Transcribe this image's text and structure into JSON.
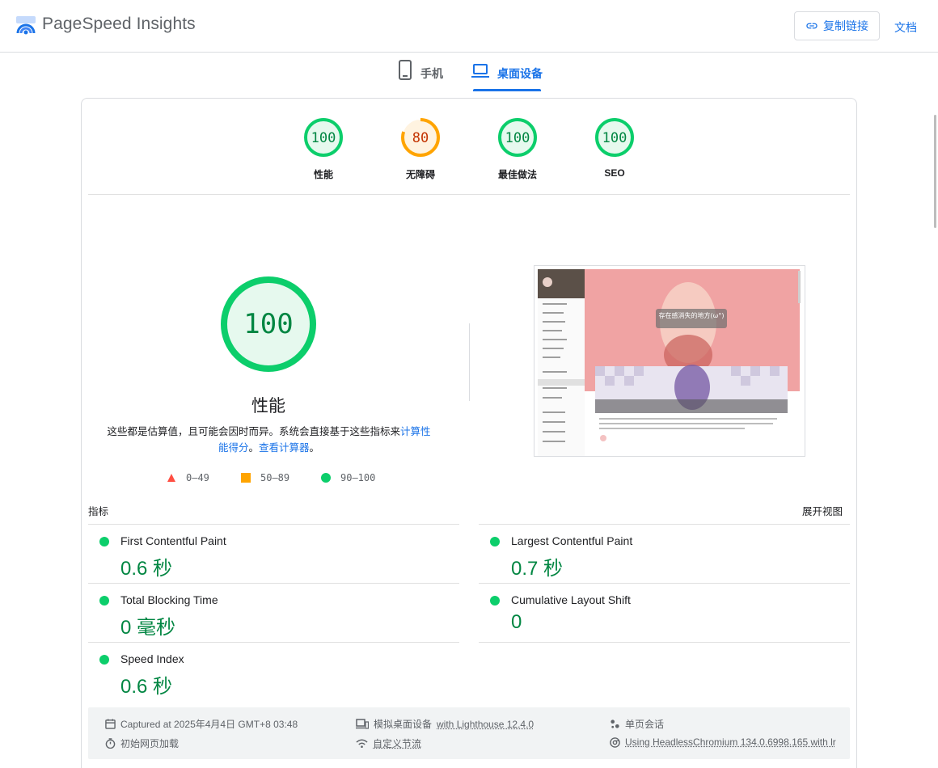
{
  "header": {
    "brand": "PageSpeed Insights",
    "copy_link_label": "复制链接",
    "docs_label": "文档"
  },
  "tabs": [
    {
      "label": "手机",
      "icon": "phone-icon",
      "active": false
    },
    {
      "label": "桌面设备",
      "icon": "laptop-icon",
      "active": true
    }
  ],
  "categories": [
    {
      "score": "100",
      "label": "性能",
      "value": 100,
      "color": "#0cce6b"
    },
    {
      "score": "80",
      "label": "无障碍",
      "value": 80,
      "color": "#ffa400"
    },
    {
      "score": "100",
      "label": "最佳做法",
      "value": 100,
      "color": "#0cce6b"
    },
    {
      "score": "100",
      "label": "SEO",
      "value": 100,
      "color": "#0cce6b"
    }
  ],
  "performance": {
    "score": "100",
    "title": "性能",
    "desc_text": "这些都是估算值，且可能会因时而异。系统会直接基于这些指标来",
    "desc_link1": "计算性能得分",
    "desc_mid": "。",
    "desc_link2": "查看计算器",
    "desc_end": "。"
  },
  "legend": [
    {
      "range": "0–49",
      "shape": "triangle",
      "color": "#ff4e42"
    },
    {
      "range": "50–89",
      "shape": "square",
      "color": "#ffa400"
    },
    {
      "range": "90–100",
      "shape": "circle",
      "color": "#0cce6b"
    }
  ],
  "metrics_section": {
    "heading": "指标",
    "expand_label": "展开视图",
    "items": [
      {
        "name": "First Contentful Paint",
        "value": "0.6 秒"
      },
      {
        "name": "Largest Contentful Paint",
        "value": "0.7 秒"
      },
      {
        "name": "Total Blocking Time",
        "value": "0 毫秒"
      },
      {
        "name": "Cumulative Layout Shift",
        "value": "0"
      },
      {
        "name": "Speed Index",
        "value": "0.6 秒"
      }
    ]
  },
  "thumbnail": {
    "banner_text": "存在感消失的地方(ω°)"
  },
  "footer": {
    "captured": "Captured at 2025年4月4日 GMT+8 03:48",
    "emulation_prefix": "模拟桌面设备",
    "emulation_link": "with Lighthouse 12.4.0",
    "session": "单页会话",
    "initial_load": "初始网页加载",
    "throttling": "自定义节流",
    "browser": "Using HeadlessChromium 134.0.6998.165 with lr"
  }
}
